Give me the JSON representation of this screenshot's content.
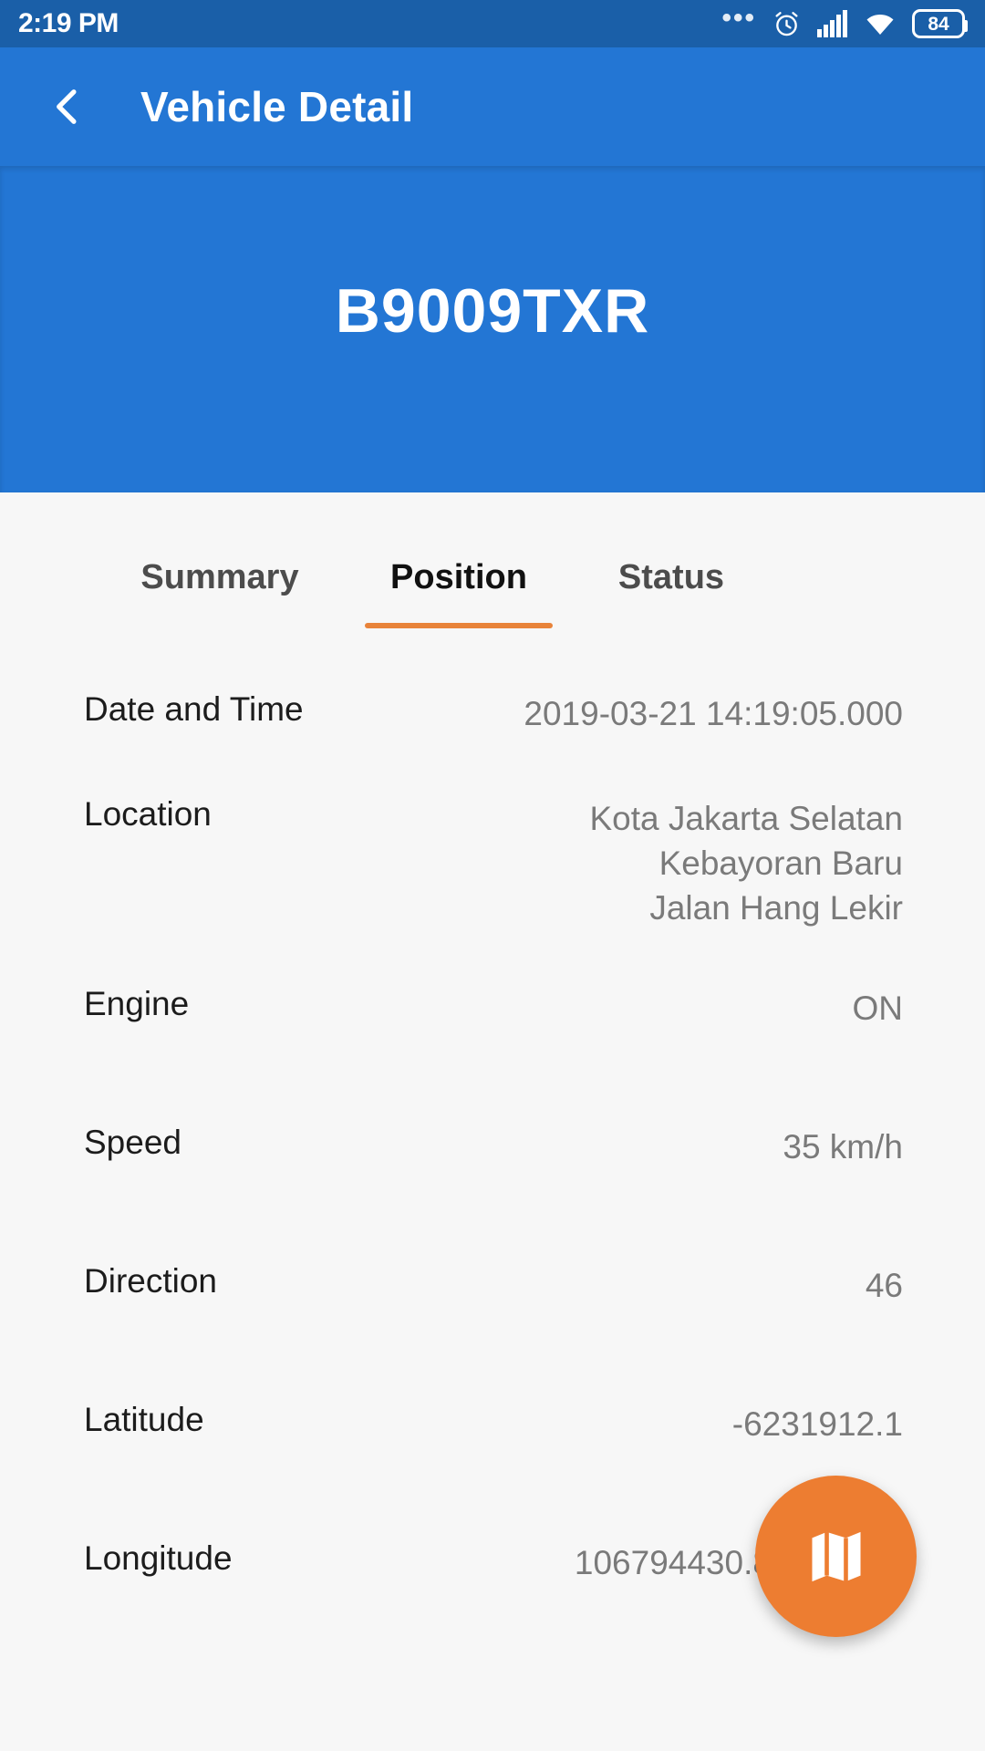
{
  "status_bar": {
    "time": "2:19 PM",
    "overflow_dots": "•••",
    "icons": [
      "alarm-clock-icon",
      "signal-bars-icon",
      "wifi-icon",
      "battery-icon"
    ],
    "battery_level": "84"
  },
  "app_bar": {
    "back_icon": "back-chevron-icon",
    "title": "Vehicle Detail"
  },
  "vehicle": {
    "plate_number": "B9009TXR"
  },
  "tabs": [
    {
      "label": "Summary",
      "active": false
    },
    {
      "label": "Position",
      "active": true
    },
    {
      "label": "Status",
      "active": false
    }
  ],
  "details": [
    {
      "label": "Date and Time",
      "value": "2019-03-21 14:19:05.000"
    },
    {
      "label": "Location",
      "value": "Kota Jakarta Selatan\nKebayoran Baru\nJalan Hang Lekir"
    },
    {
      "label": "Engine",
      "value": "ON"
    },
    {
      "label": "Speed",
      "value": "35 km/h"
    },
    {
      "label": "Direction",
      "value": "46"
    },
    {
      "label": "Latitude",
      "value": "-6231912.1"
    },
    {
      "label": "Longitude",
      "value": "106794430.80000001"
    }
  ],
  "fab": {
    "icon": "map-icon"
  },
  "colors": {
    "status_bar_bg": "#1A5FA8",
    "app_bar_bg": "#2376D4",
    "banner_bg": "#2376D4",
    "content_bg": "#F7F7F7",
    "accent_orange": "#E8833A",
    "fab_orange": "#ED7D31",
    "label_text": "#1C1C1C",
    "value_text": "#7A7A7A"
  }
}
